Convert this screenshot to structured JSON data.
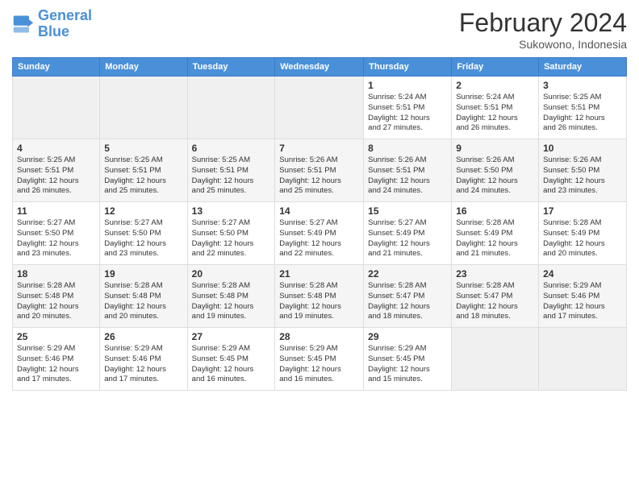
{
  "header": {
    "logo_line1": "General",
    "logo_line2": "Blue",
    "month": "February 2024",
    "location": "Sukowono, Indonesia"
  },
  "weekdays": [
    "Sunday",
    "Monday",
    "Tuesday",
    "Wednesday",
    "Thursday",
    "Friday",
    "Saturday"
  ],
  "weeks": [
    [
      {
        "day": "",
        "info": ""
      },
      {
        "day": "",
        "info": ""
      },
      {
        "day": "",
        "info": ""
      },
      {
        "day": "",
        "info": ""
      },
      {
        "day": "1",
        "info": "Sunrise: 5:24 AM\nSunset: 5:51 PM\nDaylight: 12 hours\nand 27 minutes."
      },
      {
        "day": "2",
        "info": "Sunrise: 5:24 AM\nSunset: 5:51 PM\nDaylight: 12 hours\nand 26 minutes."
      },
      {
        "day": "3",
        "info": "Sunrise: 5:25 AM\nSunset: 5:51 PM\nDaylight: 12 hours\nand 26 minutes."
      }
    ],
    [
      {
        "day": "4",
        "info": "Sunrise: 5:25 AM\nSunset: 5:51 PM\nDaylight: 12 hours\nand 26 minutes."
      },
      {
        "day": "5",
        "info": "Sunrise: 5:25 AM\nSunset: 5:51 PM\nDaylight: 12 hours\nand 25 minutes."
      },
      {
        "day": "6",
        "info": "Sunrise: 5:25 AM\nSunset: 5:51 PM\nDaylight: 12 hours\nand 25 minutes."
      },
      {
        "day": "7",
        "info": "Sunrise: 5:26 AM\nSunset: 5:51 PM\nDaylight: 12 hours\nand 25 minutes."
      },
      {
        "day": "8",
        "info": "Sunrise: 5:26 AM\nSunset: 5:51 PM\nDaylight: 12 hours\nand 24 minutes."
      },
      {
        "day": "9",
        "info": "Sunrise: 5:26 AM\nSunset: 5:50 PM\nDaylight: 12 hours\nand 24 minutes."
      },
      {
        "day": "10",
        "info": "Sunrise: 5:26 AM\nSunset: 5:50 PM\nDaylight: 12 hours\nand 23 minutes."
      }
    ],
    [
      {
        "day": "11",
        "info": "Sunrise: 5:27 AM\nSunset: 5:50 PM\nDaylight: 12 hours\nand 23 minutes."
      },
      {
        "day": "12",
        "info": "Sunrise: 5:27 AM\nSunset: 5:50 PM\nDaylight: 12 hours\nand 23 minutes."
      },
      {
        "day": "13",
        "info": "Sunrise: 5:27 AM\nSunset: 5:50 PM\nDaylight: 12 hours\nand 22 minutes."
      },
      {
        "day": "14",
        "info": "Sunrise: 5:27 AM\nSunset: 5:49 PM\nDaylight: 12 hours\nand 22 minutes."
      },
      {
        "day": "15",
        "info": "Sunrise: 5:27 AM\nSunset: 5:49 PM\nDaylight: 12 hours\nand 21 minutes."
      },
      {
        "day": "16",
        "info": "Sunrise: 5:28 AM\nSunset: 5:49 PM\nDaylight: 12 hours\nand 21 minutes."
      },
      {
        "day": "17",
        "info": "Sunrise: 5:28 AM\nSunset: 5:49 PM\nDaylight: 12 hours\nand 20 minutes."
      }
    ],
    [
      {
        "day": "18",
        "info": "Sunrise: 5:28 AM\nSunset: 5:48 PM\nDaylight: 12 hours\nand 20 minutes."
      },
      {
        "day": "19",
        "info": "Sunrise: 5:28 AM\nSunset: 5:48 PM\nDaylight: 12 hours\nand 20 minutes."
      },
      {
        "day": "20",
        "info": "Sunrise: 5:28 AM\nSunset: 5:48 PM\nDaylight: 12 hours\nand 19 minutes."
      },
      {
        "day": "21",
        "info": "Sunrise: 5:28 AM\nSunset: 5:48 PM\nDaylight: 12 hours\nand 19 minutes."
      },
      {
        "day": "22",
        "info": "Sunrise: 5:28 AM\nSunset: 5:47 PM\nDaylight: 12 hours\nand 18 minutes."
      },
      {
        "day": "23",
        "info": "Sunrise: 5:28 AM\nSunset: 5:47 PM\nDaylight: 12 hours\nand 18 minutes."
      },
      {
        "day": "24",
        "info": "Sunrise: 5:29 AM\nSunset: 5:46 PM\nDaylight: 12 hours\nand 17 minutes."
      }
    ],
    [
      {
        "day": "25",
        "info": "Sunrise: 5:29 AM\nSunset: 5:46 PM\nDaylight: 12 hours\nand 17 minutes."
      },
      {
        "day": "26",
        "info": "Sunrise: 5:29 AM\nSunset: 5:46 PM\nDaylight: 12 hours\nand 17 minutes."
      },
      {
        "day": "27",
        "info": "Sunrise: 5:29 AM\nSunset: 5:45 PM\nDaylight: 12 hours\nand 16 minutes."
      },
      {
        "day": "28",
        "info": "Sunrise: 5:29 AM\nSunset: 5:45 PM\nDaylight: 12 hours\nand 16 minutes."
      },
      {
        "day": "29",
        "info": "Sunrise: 5:29 AM\nSunset: 5:45 PM\nDaylight: 12 hours\nand 15 minutes."
      },
      {
        "day": "",
        "info": ""
      },
      {
        "day": "",
        "info": ""
      }
    ]
  ]
}
